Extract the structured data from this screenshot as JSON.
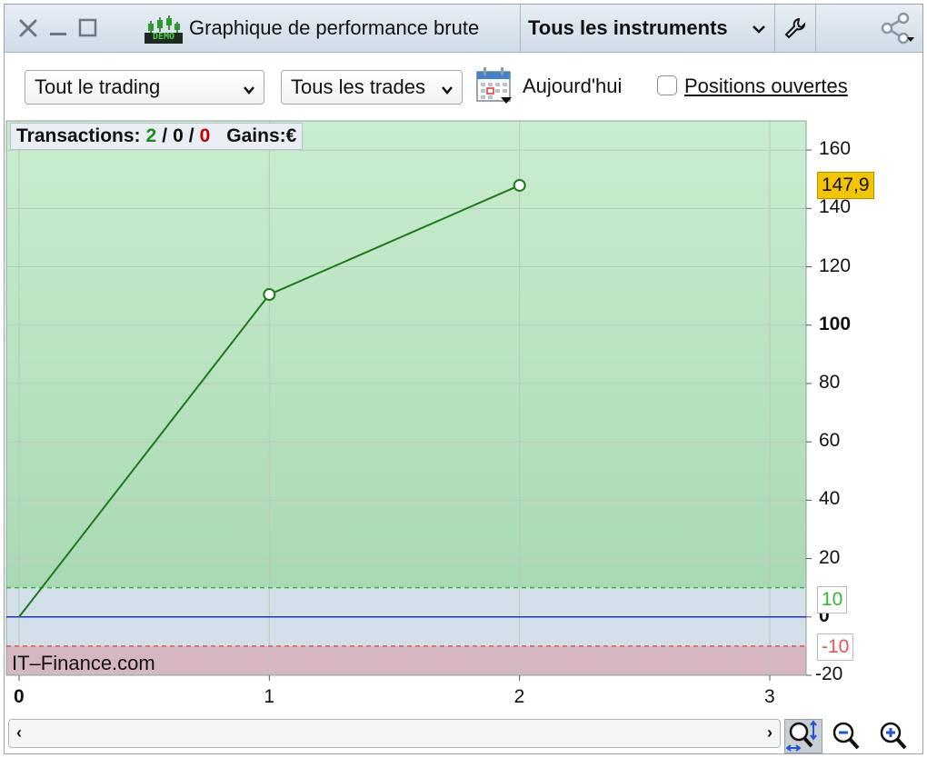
{
  "window": {
    "title": "Graphique de performance brute",
    "demo_badge": "DEMO",
    "instrument_selector": "Tous les instruments",
    "icons": [
      "close-icon",
      "minimize-icon",
      "maximize-icon",
      "wrench-icon",
      "share-icon"
    ]
  },
  "toolbar": {
    "scope_select": "Tout le trading",
    "trades_select": "Tous les trades",
    "date_label": "Aujourd'hui",
    "open_positions_label": "Positions ouvertes",
    "open_positions_checked": false
  },
  "summary": {
    "transactions_label": "Transactions:",
    "wins": "2",
    "sep1": "/",
    "neutral": "0",
    "sep2": "/",
    "losses": "0",
    "gains_label": "Gains:",
    "currency": "€"
  },
  "watermark": "IT–Finance.com",
  "colors": {
    "line": "#1a7a1a",
    "profit_zone_top": "#c9edcf",
    "profit_zone_bottom": "#a9d9b4",
    "neutral_zone": "#d3e0ea",
    "loss_zone": "#d6b7bf",
    "upper_threshold": "#35b835",
    "lower_threshold": "#e05555",
    "zero_line": "#2233bb",
    "last_value_badge": "#f2c500",
    "wins_color": "#1d8a1d",
    "losses_color": "#c00000"
  },
  "chart_data": {
    "type": "line",
    "x": [
      0,
      1,
      2
    ],
    "y": [
      0,
      110.5,
      147.9
    ],
    "xlim": [
      0,
      3
    ],
    "ylim": [
      -20,
      170
    ],
    "y_ticks": [
      "160",
      "140",
      "120",
      "100",
      "80",
      "60",
      "40",
      "20",
      "0",
      "-20"
    ],
    "x_ticks": [
      "0",
      "1",
      "2",
      "3"
    ],
    "last_value_label": "147,9",
    "upper_threshold": 10,
    "upper_threshold_label": "10",
    "lower_threshold": -10,
    "lower_threshold_label": "-10",
    "grid": true
  }
}
